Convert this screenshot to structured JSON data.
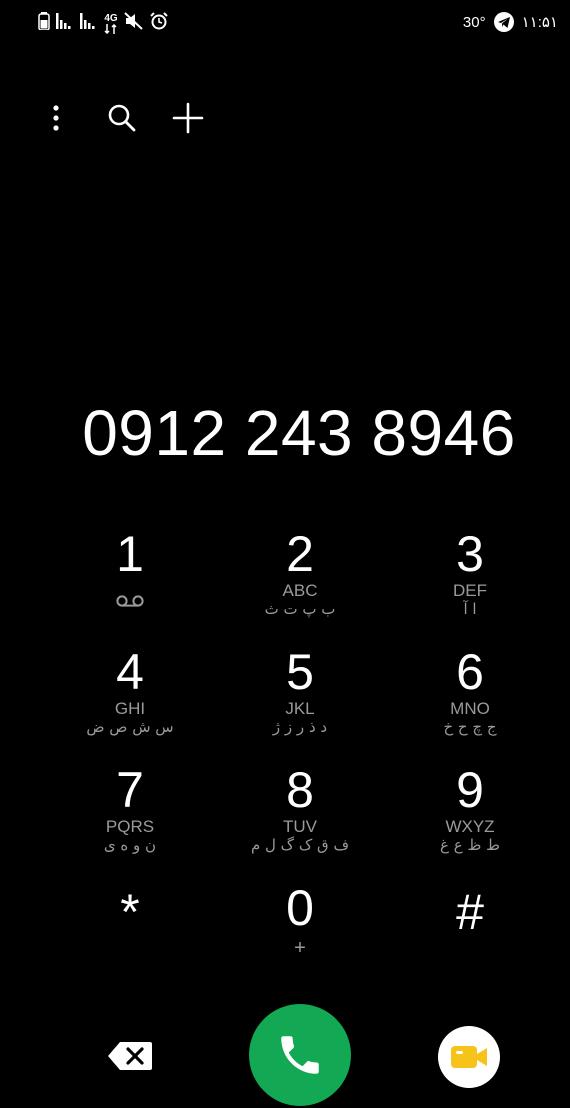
{
  "status_bar": {
    "left_icons": [
      "battery-icon",
      "signal-icon",
      "signal-icon",
      "network-4g-icon",
      "mute-icon",
      "alarm-icon"
    ],
    "network_type": "4G",
    "temperature": "30°",
    "time": "۱۱:۵۱"
  },
  "toolbar": {
    "icons": [
      "more-vert-icon",
      "search-icon",
      "add-icon"
    ]
  },
  "dialed_number": "0912 243 8946",
  "keypad": {
    "keys": [
      {
        "digit": "1",
        "latin": "",
        "farsi": ""
      },
      {
        "digit": "2",
        "latin": "ABC",
        "farsi": "ب پ ت ث"
      },
      {
        "digit": "3",
        "latin": "DEF",
        "farsi": "ا آ"
      },
      {
        "digit": "4",
        "latin": "GHI",
        "farsi": "س ش ص ض"
      },
      {
        "digit": "5",
        "latin": "JKL",
        "farsi": "د ذ ر ز ژ"
      },
      {
        "digit": "6",
        "latin": "MNO",
        "farsi": "ج چ ح خ"
      },
      {
        "digit": "7",
        "latin": "PQRS",
        "farsi": "ن و ه ی"
      },
      {
        "digit": "8",
        "latin": "TUV",
        "farsi": "ف ق ک گ ل م"
      },
      {
        "digit": "9",
        "latin": "WXYZ",
        "farsi": "ط ظ ع غ"
      },
      {
        "digit": "*",
        "latin": "",
        "farsi": ""
      },
      {
        "digit": "0",
        "latin": "+",
        "farsi": ""
      },
      {
        "digit": "#",
        "latin": "",
        "farsi": ""
      }
    ]
  },
  "colors": {
    "background": "#000000",
    "call_button": "#13a854",
    "video_icon": "#f6c31b",
    "secondary_text": "#9a9a9a"
  }
}
